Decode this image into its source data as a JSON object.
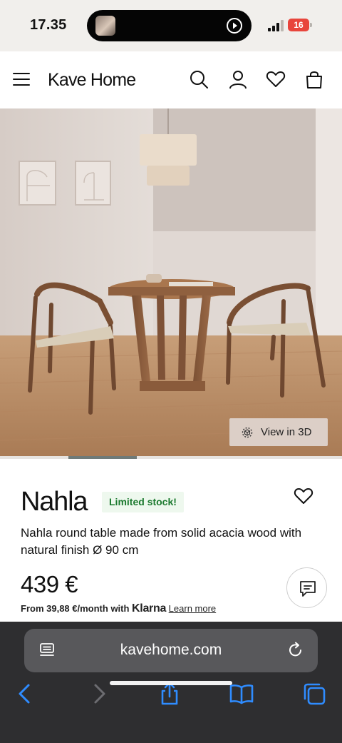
{
  "status_bar": {
    "time": "17.35",
    "battery": "16"
  },
  "header": {
    "brand": "Kave Home",
    "icons": [
      "menu-icon",
      "search-icon",
      "account-icon",
      "wishlist-icon",
      "bag-icon"
    ]
  },
  "hero": {
    "view_3d_label": "View in 3D",
    "gallery_position": 0.2
  },
  "product": {
    "name": "Nahla",
    "badge": "Limited stock!",
    "description": "Nahla round table made from solid acacia wood with natural finish Ø 90 cm",
    "price": "439 €",
    "financing": {
      "prefix": "From ",
      "amount": "39,88 €/month",
      "with": " with ",
      "provider": "Klarna",
      "link": "Learn more"
    }
  },
  "browser": {
    "url": "kavehome.com",
    "toolbar": [
      "back-icon",
      "forward-icon",
      "share-icon",
      "bookmarks-icon",
      "tabs-icon"
    ]
  },
  "colors": {
    "accent_green": "#1c7a2f",
    "badge_bg": "#eef8ee",
    "safari_bg": "#2e2e30",
    "safari_blue": "#2f8cff"
  }
}
